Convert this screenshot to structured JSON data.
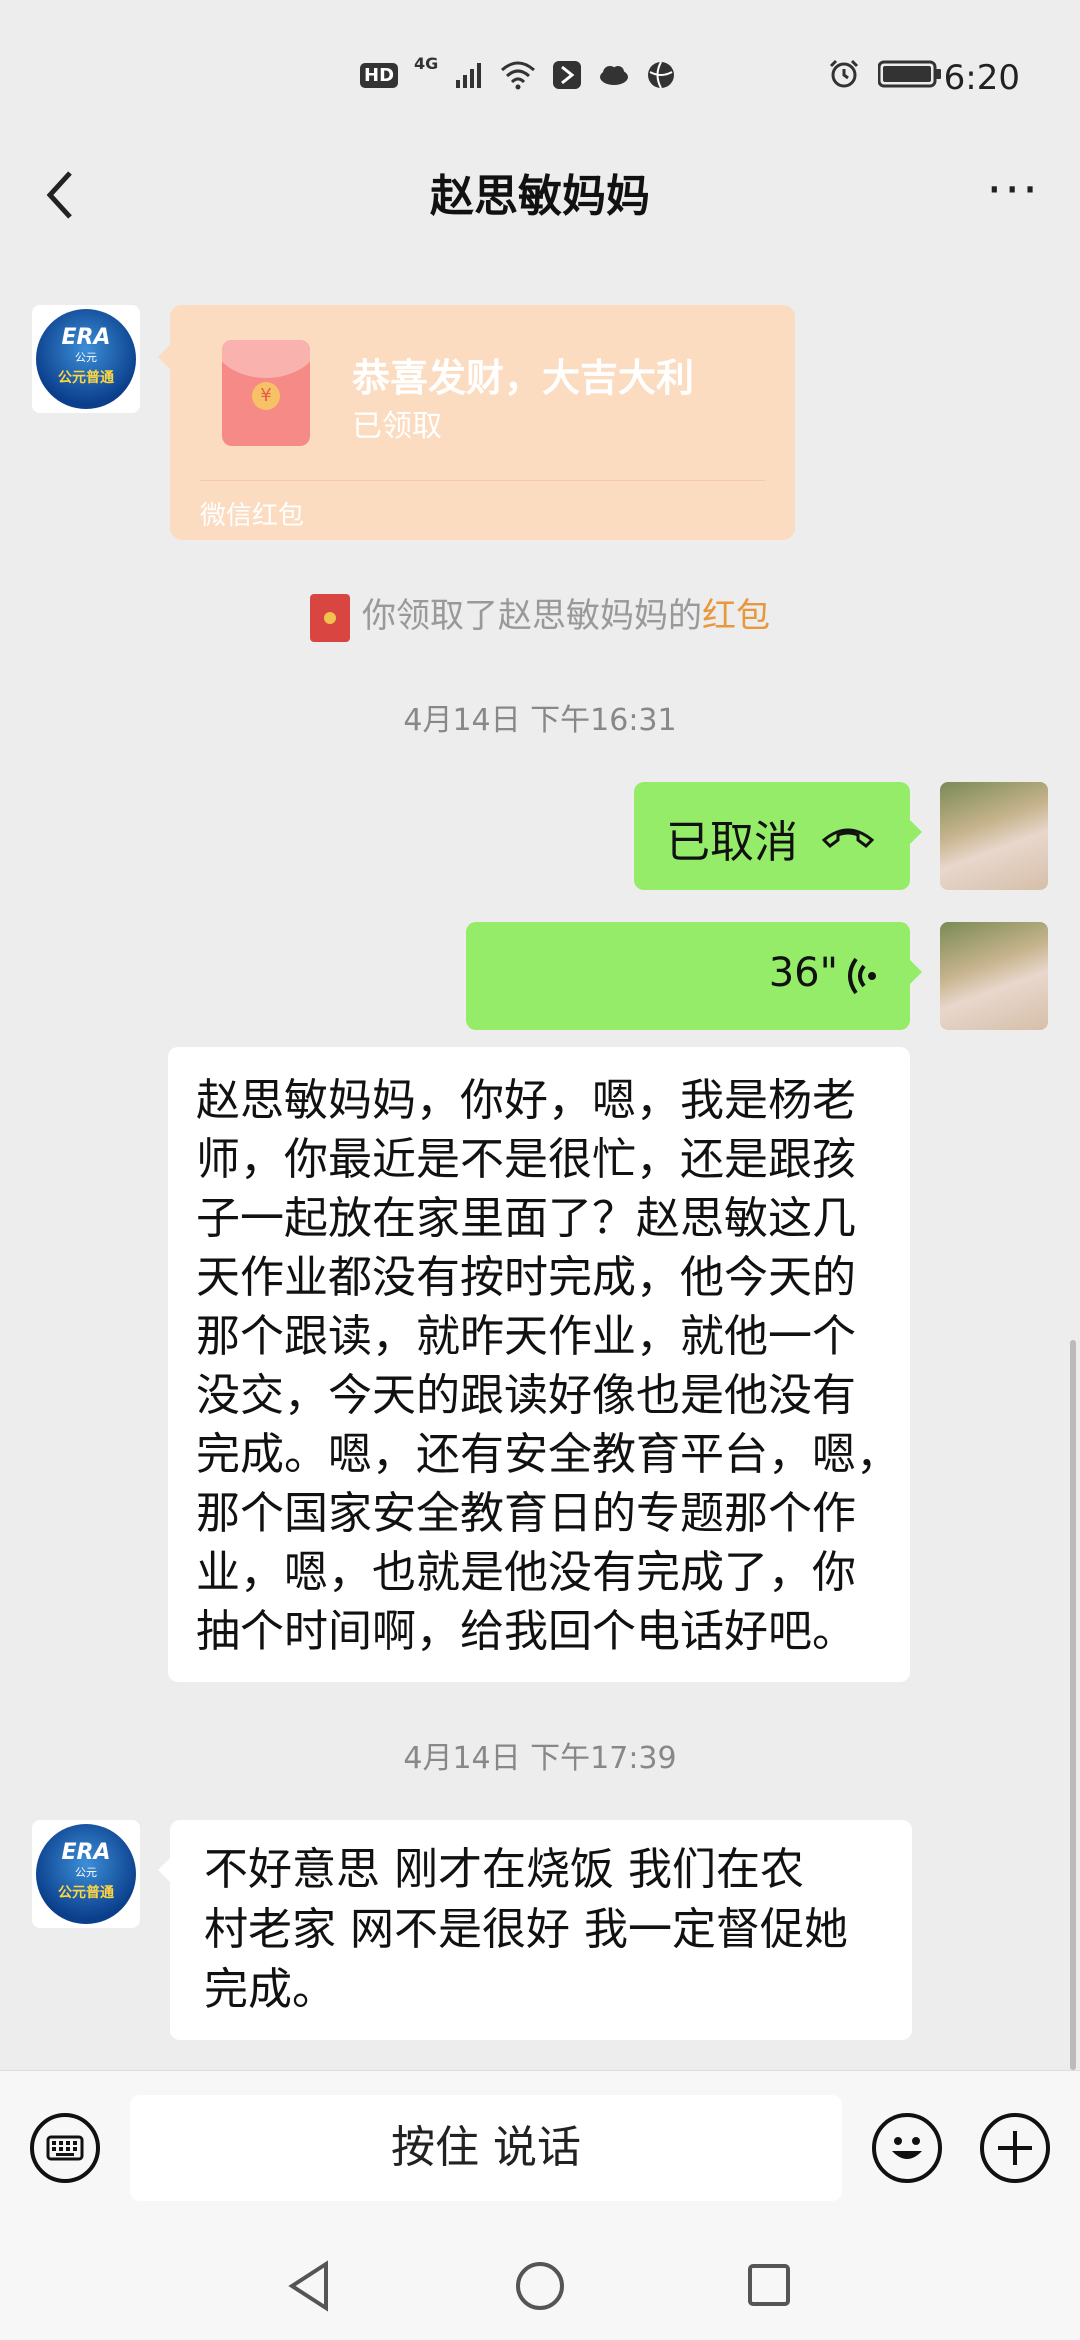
{
  "status_bar": {
    "network_badge": "HD",
    "network_type": "4G",
    "time": "6:20"
  },
  "header": {
    "title": "赵思敏妈妈"
  },
  "red_packet": {
    "greeting": "恭喜发财，大吉大利",
    "status": "已领取",
    "label": "微信红包"
  },
  "system_note": {
    "text": "你领取了赵思敏妈妈的",
    "highlight": "红包"
  },
  "timestamps": [
    "4月14日 下午16:31",
    "4月14日 下午17:39"
  ],
  "messages": {
    "call_cancelled": "已取消",
    "voice_duration": "36\"",
    "teacher_lines": [
      "赵思敏妈妈，你好，嗯，我是杨老",
      "师，你最近是不是很忙，还是跟孩",
      "子一起放在家里面了？赵思敏这几",
      "天作业都没有按时完成，他今天的",
      "那个跟读，就昨天作业，就他一个",
      "没交，今天的跟读好像也是他没有",
      "完成。嗯，还有安全教育平台，嗯，",
      "那个国家安全教育日的专题那个作",
      "业，嗯，也就是他没有完成了，你",
      "抽个时间啊，给我回个电话好吧。"
    ],
    "reply_lines": [
      "不好意思  刚才在烧饭   我们在农",
      "村老家  网不是很好  我一定督促她",
      "完成。"
    ]
  },
  "avatar_logo": {
    "line1": "ERA",
    "line2": "公元",
    "line3": "公元普通"
  },
  "input": {
    "hold_to_talk": "按住 说话"
  }
}
